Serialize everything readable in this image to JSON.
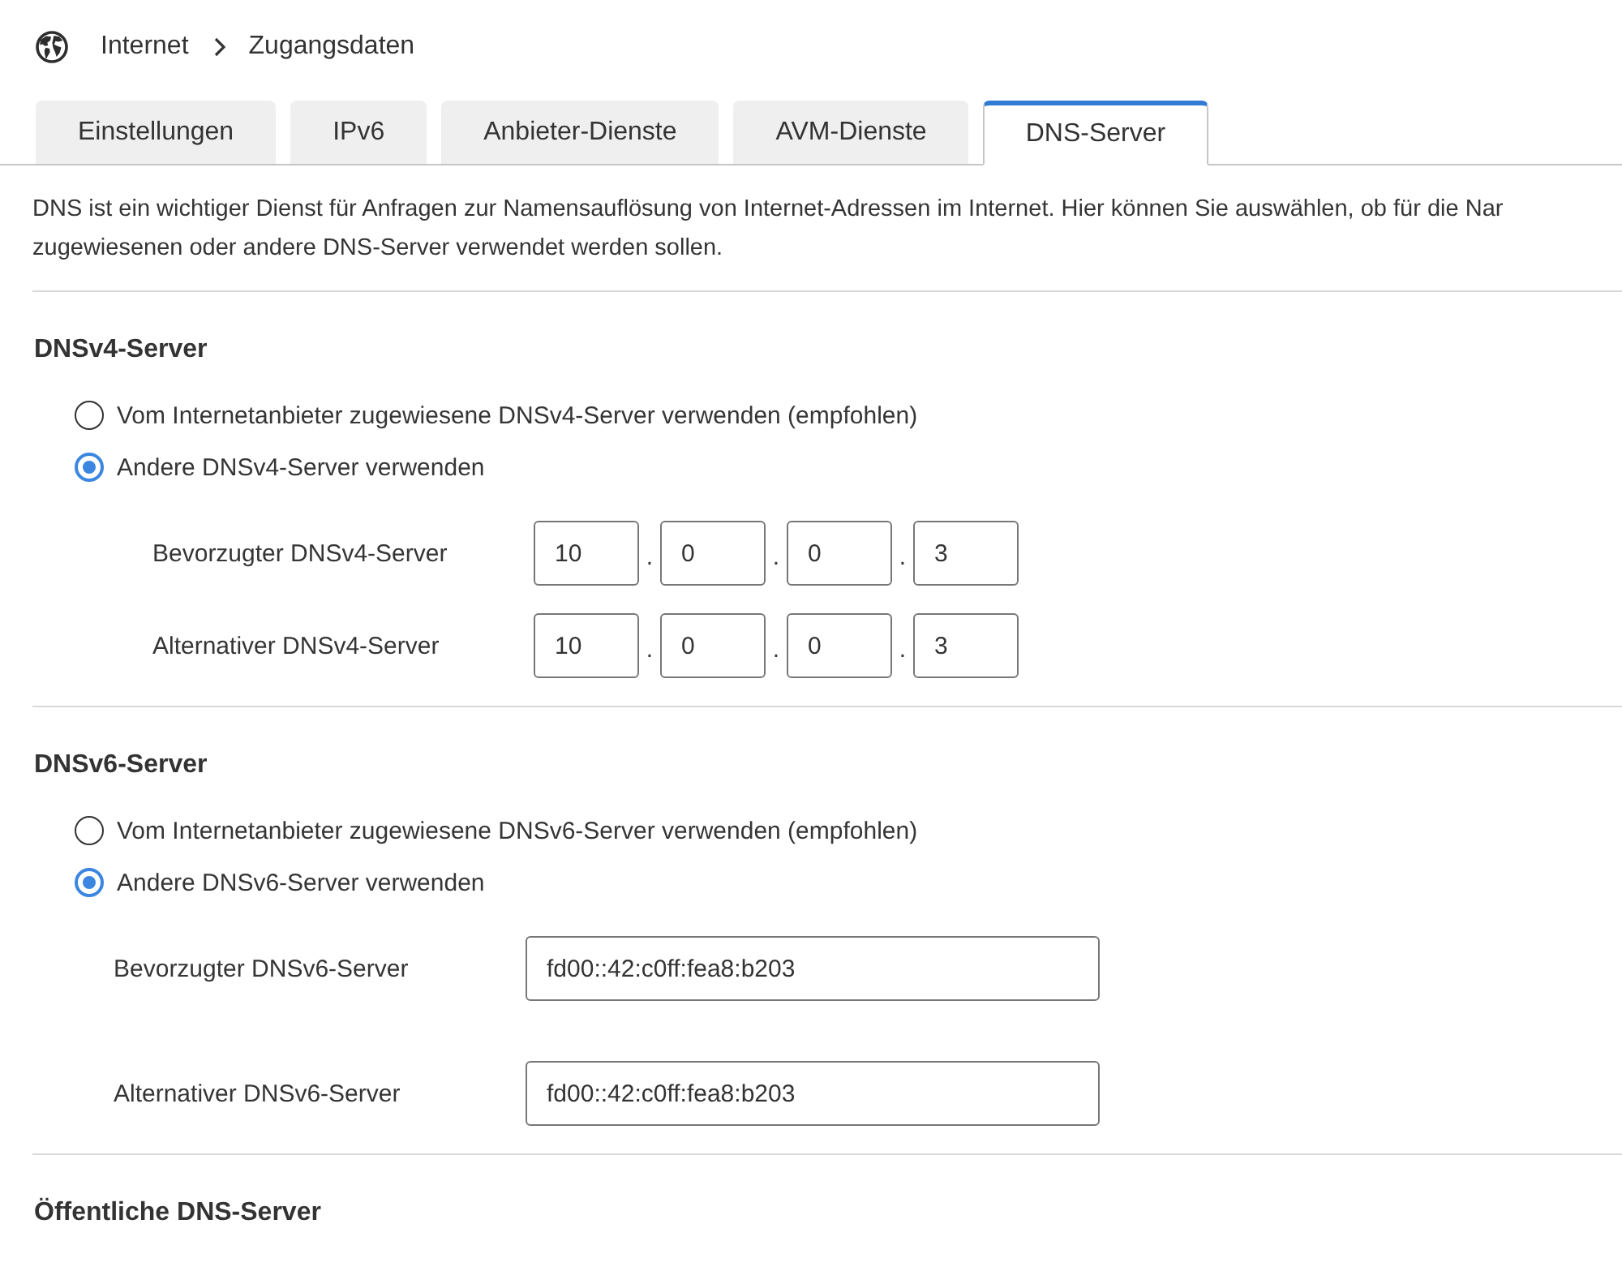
{
  "breadcrumb": {
    "items": [
      "Internet",
      "Zugangsdaten"
    ]
  },
  "tabs": [
    {
      "label": "Einstellungen",
      "selected": false
    },
    {
      "label": "IPv6",
      "selected": false
    },
    {
      "label": "Anbieter-Dienste",
      "selected": false
    },
    {
      "label": "AVM-Dienste",
      "selected": false
    },
    {
      "label": "DNS-Server",
      "selected": true
    }
  ],
  "description": {
    "lines": [
      "DNS ist ein wichtiger Dienst für Anfragen zur Namensauflösung von Internet-Adressen im Internet. Hier können Sie auswählen, ob für die Nar",
      "zugewiesenen oder andere DNS-Server verwendet werden sollen."
    ]
  },
  "sections": [
    {
      "title": "DNSv4-Server",
      "options": [
        {
          "label": "Vom Internetanbieter zugewiesene DNSv4-Server verwenden (empfohlen)",
          "selected": false
        },
        {
          "label": "Andere DNSv4-Server verwenden",
          "selected": true
        }
      ],
      "fields": [
        {
          "kind": "ipv4",
          "label": "Bevorzugter DNSv4-Server",
          "separator": ".",
          "octets": [
            "10",
            "0",
            "0",
            "3"
          ]
        },
        {
          "kind": "ipv4",
          "label": "Alternativer DNSv4-Server",
          "separator": ".",
          "octets": [
            "10",
            "0",
            "0",
            "3"
          ]
        }
      ]
    },
    {
      "title": "DNSv6-Server",
      "options": [
        {
          "label": "Vom Internetanbieter zugewiesene DNSv6-Server verwenden (empfohlen)",
          "selected": false
        },
        {
          "label": "Andere DNSv6-Server verwenden",
          "selected": true
        }
      ],
      "fields": [
        {
          "kind": "ipv6",
          "label": "Bevorzugter DNSv6-Server",
          "value": "fd00::42:c0ff:fea8:b203"
        },
        {
          "kind": "ipv6",
          "label": "Alternativer DNSv6-Server",
          "value": "fd00::42:c0ff:fea8:b203"
        }
      ]
    },
    {
      "title": "Öffentliche DNS-Server"
    }
  ]
}
